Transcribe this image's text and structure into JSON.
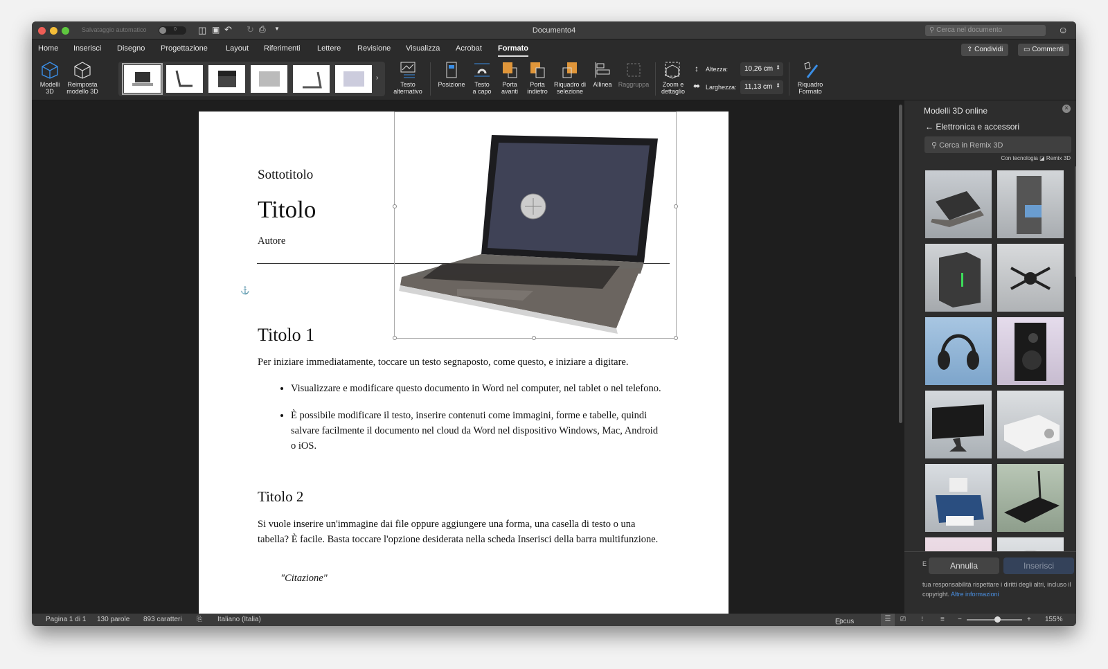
{
  "titlebar": {
    "title": "Documento4",
    "autosave_label": "Salvataggio automatico",
    "autosave_state": "0",
    "search_placeholder": "Cerca nel documento"
  },
  "tabs": [
    "Home",
    "Inserisci",
    "Disegno",
    "Progettazione",
    "Layout",
    "Riferimenti",
    "Lettere",
    "Revisione",
    "Visualizza",
    "Acrobat",
    "Formato"
  ],
  "active_tab": "Formato",
  "share": {
    "condividi": "Condividi",
    "commenti": "Commenti"
  },
  "ribbon": {
    "modelli": [
      "Modelli",
      "3D"
    ],
    "reimposta": [
      "Reimposta",
      "modello 3D"
    ],
    "testo_alt": [
      "Testo",
      "alternativo"
    ],
    "posizione": "Posizione",
    "testo_capo": [
      "Testo",
      "a capo"
    ],
    "porta_avanti": [
      "Porta",
      "avanti"
    ],
    "porta_indietro": [
      "Porta",
      "indietro"
    ],
    "riquadro_sel": [
      "Riquadro di",
      "selezione"
    ],
    "allinea": "Allinea",
    "raggruppa": "Raggruppa",
    "zoom": [
      "Zoom e",
      "dettaglio"
    ],
    "altezza_label": "Altezza:",
    "altezza": "10,26 cm",
    "larghezza_label": "Larghezza:",
    "larghezza": "11,13 cm",
    "riquadro_formato": [
      "Riquadro",
      "Formato"
    ]
  },
  "document": {
    "subtitle": "Sottotitolo",
    "title": "Titolo",
    "author": "Autore",
    "h1": "Titolo 1",
    "p1": "Per iniziare immediatamente, toccare un testo segnaposto, come questo, e iniziare a digitare.",
    "bullets": [
      "Visualizzare e modificare questo documento in Word nel computer, nel tablet o nel telefono.",
      "È possibile modificare il testo, inserire contenuti come immagini, forme e tabelle, quindi salvare facilmente il documento nel cloud da Word nel dispositivo Windows, Mac, Android o iOS."
    ],
    "h2": "Titolo 2",
    "p2": "Si vuole inserire un'immagine dai file oppure aggiungere una forma, una casella di testo o una tabella? È facile. Basta toccare l'opzione desiderata nella scheda Inserisci della barra multifunzione.",
    "quote": "\"Citazione\""
  },
  "panel": {
    "title": "Modelli 3D online",
    "category": "Elettronica e accessori",
    "search_placeholder": "Cerca in Remix 3D",
    "powered": "Con tecnologia",
    "powered_brand": "Remix 3D",
    "items": [
      "laptop",
      "server-tower",
      "server-box",
      "drone",
      "headphones",
      "speaker",
      "monitor",
      "projector",
      "printer",
      "router",
      "pink-item",
      "disc"
    ],
    "cancel": "Annulla",
    "insert": "Inserisci",
    "notice_prefix": "E",
    "notice": "tua responsabilità rispettare i diritti degli altri, incluso il copyright.",
    "link": "Altre informazioni"
  },
  "status": {
    "page": "Pagina 1 di 1",
    "words": "130 parole",
    "chars": "893 caratteri",
    "language": "Italiano (Italia)",
    "focus": "Focus",
    "zoom": "155%"
  },
  "colors": {
    "accent_orange": "#e0963a",
    "link": "#4a90e2",
    "insert_bg": "#34425a"
  }
}
